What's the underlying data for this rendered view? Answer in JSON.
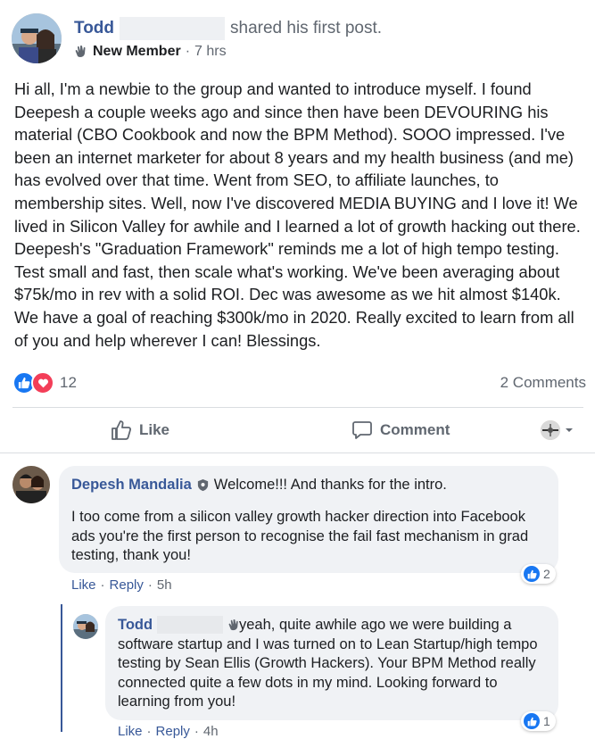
{
  "post": {
    "author": "Todd",
    "action": "shared his first post.",
    "badge": "New Member",
    "time": "7 hrs",
    "separator": "·",
    "body": "Hi all, I'm a newbie to the group and wanted to introduce myself. I found Deepesh a couple weeks ago and since then have been DEVOURING his material (CBO Cookbook and now the BPM Method). SOOO impressed. I've been an internet marketer for about 8 years and my health business (and me) has evolved over that time. Went from SEO, to affiliate launches, to membership sites. Well, now I've discovered MEDIA BUYING and I love it! We lived in Silicon Valley for awhile and I learned a lot of growth hacking out there. Deepesh's \"Graduation Framework\" reminds me a lot of high tempo testing. Test small and fast, then scale what's working. We've been averaging about $75k/mo in rev with a solid ROI. Dec was awesome as we hit almost $140k. We have a goal of reaching $300k/mo in 2020. Really excited to learn from all of you and help wherever I can! Blessings.",
    "reaction_count": "12",
    "comment_count": "2 Comments"
  },
  "actions": {
    "like": "Like",
    "comment": "Comment"
  },
  "comments": [
    {
      "author": "Depesh Mandalia",
      "first_line": "Welcome!!! And thanks for the intro.",
      "text": "I too come from a silicon valley growth hacker direction into Facebook ads you're the first person to recognise the fail fast mechanism in grad testing, thank you!",
      "like": "Like",
      "reply": "Reply",
      "time": "5h",
      "reactions": "2"
    },
    {
      "author": "Todd",
      "text": "yeah, quite awhile ago we were building a software startup and I was turned on to Lean Startup/high tempo testing by Sean Ellis (Growth Hackers). Your BPM Method really connected quite a few dots in my mind. Looking forward to learning from you!",
      "like": "Like",
      "reply": "Reply",
      "time": "4h",
      "reactions": "1"
    }
  ],
  "colors": {
    "link_blue": "#385898",
    "like_blue": "#1877f2",
    "love_red": "#f33e58",
    "secondary_text": "#606770",
    "bubble_bg": "#f0f2f5"
  }
}
